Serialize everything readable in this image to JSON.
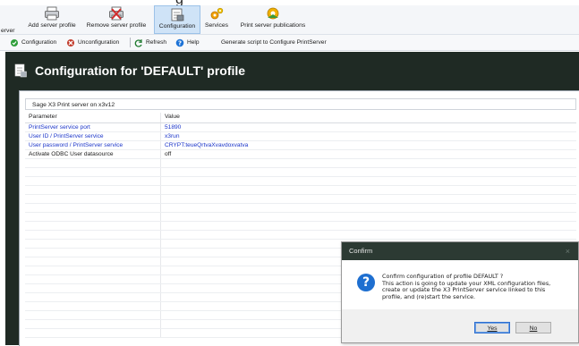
{
  "ribbon": {
    "cut_label": "erver",
    "buttons": [
      {
        "label": "Add server profile"
      },
      {
        "label": "Remove server profile"
      },
      {
        "label": "Configuration"
      },
      {
        "label": "Services"
      },
      {
        "label": "Print server publications"
      }
    ]
  },
  "toolbar": {
    "items": [
      {
        "label": "Configuration"
      },
      {
        "label": "Unconfiguration"
      },
      {
        "label": "Refresh"
      },
      {
        "label": "Help"
      },
      {
        "label": "Generate script to Configure PrintServer"
      }
    ]
  },
  "page": {
    "title": "Configuration for 'DEFAULT' profile",
    "group_label": "Sage X3 Print server on x3v12"
  },
  "grid": {
    "columns": [
      "Parameter",
      "Value"
    ],
    "rows": [
      {
        "param": "PrintServer service port",
        "value": "51890"
      },
      {
        "param": "User ID / PrintServer service",
        "value": "x3run"
      },
      {
        "param": "User password / PrintServer service",
        "value": "CRYPT:teueQrtvaXvavdoxvatva"
      },
      {
        "param": "Activate ODBC User datasource",
        "value": "off"
      }
    ]
  },
  "dialog": {
    "title": "Confirm",
    "close": "×",
    "icon": "?",
    "message_lines": [
      "Confirm configuration of profile DEFAULT ?",
      "This action is going to update your XML configuration files,",
      "create or update the X3 PrintServer service linked to this",
      "profile, and (re)start the service."
    ],
    "yes_label": "Yes",
    "no_label": "No"
  },
  "colors": {
    "frame": "#1f2a24",
    "param_link": "#1b35c9",
    "dialog_title_bar": "#2c3a33",
    "ribbon_active": "#cfe3f7"
  }
}
